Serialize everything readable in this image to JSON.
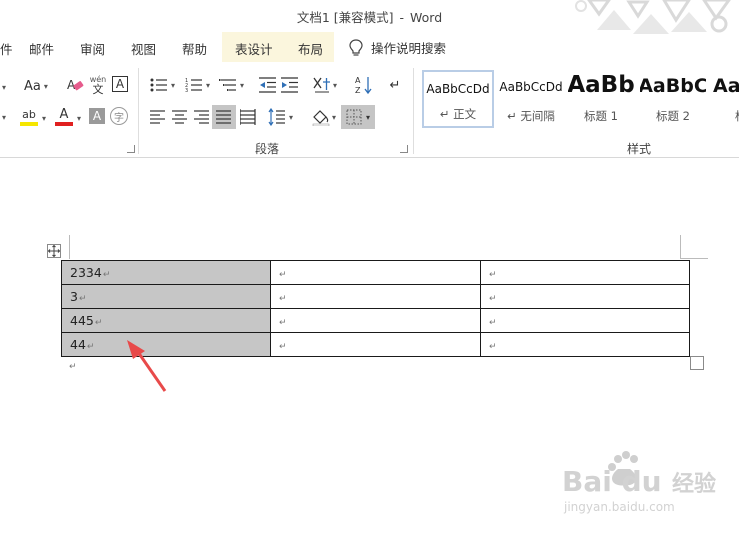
{
  "window": {
    "doc_name": "文档1 [兼容模式]",
    "separator": "-",
    "app_name": "Word"
  },
  "tabs": [
    {
      "label": "件"
    },
    {
      "label": "邮件"
    },
    {
      "label": "审阅"
    },
    {
      "label": "视图"
    },
    {
      "label": "帮助"
    },
    {
      "label": "表设计"
    },
    {
      "label": "布局"
    }
  ],
  "tell_me": {
    "label": "操作说明搜索"
  },
  "ribbon": {
    "font_group": {
      "font_size_glyph": "Aa",
      "phonetic_top": "wén",
      "phonetic_bottom": "文",
      "border_char": "A",
      "shading_char": "A",
      "enclose_char": "字",
      "highlight_glyph": "ab",
      "font_color_glyph": "A",
      "highlight_color": "#f5e600",
      "font_color": "#e02020"
    },
    "paragraph_group": {
      "label": "段落"
    },
    "styles_group": {
      "label": "样式",
      "styles": [
        {
          "sample": "AaBbCcDd",
          "name": "↵ 正文"
        },
        {
          "sample": "AaBbCcDd",
          "name": "↵ 无间隔"
        },
        {
          "sample": "AaBb",
          "name": "标题 1"
        },
        {
          "sample": "AaBbC",
          "name": "标题 2"
        },
        {
          "sample": "Aa",
          "name": "标"
        }
      ]
    }
  },
  "document": {
    "table": {
      "rows": [
        [
          "2334",
          "",
          ""
        ],
        [
          "3",
          "",
          ""
        ],
        [
          "445",
          "",
          ""
        ],
        [
          "44",
          "",
          ""
        ]
      ],
      "selected_column": 0,
      "selection_color": "#c6c6c6"
    },
    "paragraph_mark": "↵"
  },
  "annotation": {
    "arrow_color": "#e84a4a"
  },
  "watermark": {
    "brand": "Bai du",
    "product": "经验",
    "url": "jingyan.baidu.com"
  }
}
